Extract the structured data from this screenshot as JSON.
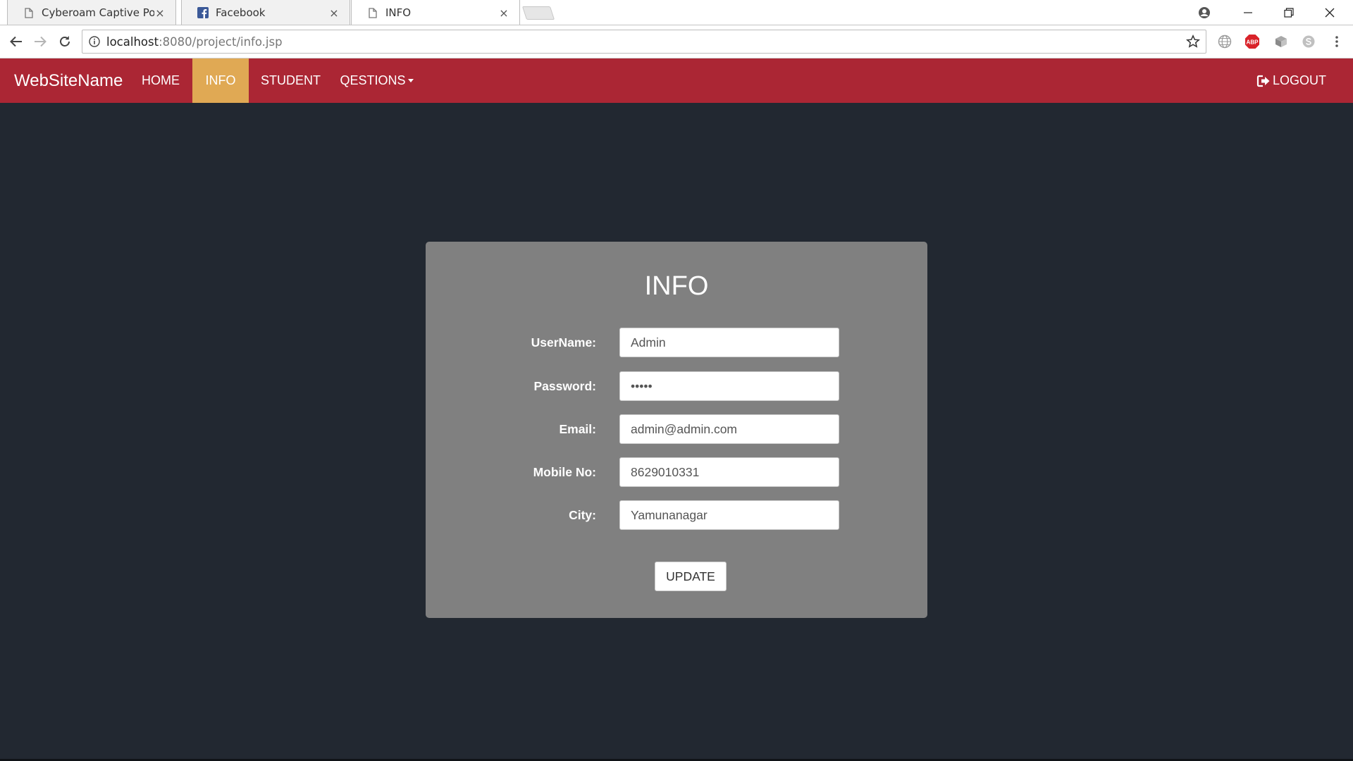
{
  "browser": {
    "tabs": [
      {
        "title": "Cyberoam Captive Portal",
        "icon": "page-icon",
        "active": false
      },
      {
        "title": "Facebook",
        "icon": "facebook-icon",
        "active": false
      },
      {
        "title": "INFO",
        "icon": "page-icon",
        "active": true
      }
    ],
    "close_glyph": "×",
    "url_host": "localhost",
    "url_rest": ":8080/project/info.jsp",
    "extensions": [
      "globe-icon",
      "adblock-icon",
      "extension-icon",
      "skype-icon"
    ],
    "adblock_label": "ABP"
  },
  "navbar": {
    "brand": "WebSiteName",
    "items": [
      {
        "label": "HOME",
        "active": false
      },
      {
        "label": "INFO",
        "active": true
      },
      {
        "label": "STUDENT",
        "active": false
      },
      {
        "label": "QESTIONS",
        "active": false,
        "dropdown": true
      }
    ],
    "logout_label": "LOGOUT",
    "colors": {
      "bar": "#ab2634",
      "active": "#e0a954"
    }
  },
  "form": {
    "title": "INFO",
    "fields": [
      {
        "label": "UserName:",
        "value": "Admin"
      },
      {
        "label": "Password:",
        "value": "•••••"
      },
      {
        "label": "Email:",
        "value": "admin@admin.com"
      },
      {
        "label": "Mobile No:",
        "value": "8629010331"
      },
      {
        "label": "City:",
        "value": "Yamunanagar"
      }
    ],
    "submit_label": "UPDATE"
  }
}
